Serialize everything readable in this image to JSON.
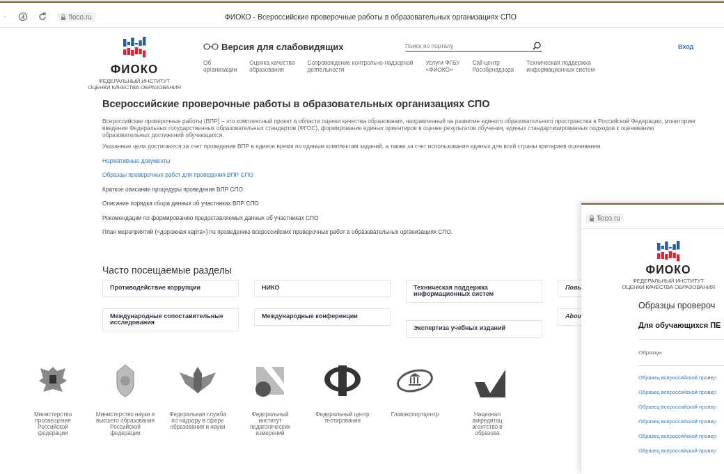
{
  "browser": {
    "url": "fioco.ru",
    "tab_title": "ФИОКО - Всероссийские проверочные работы в образовательных организациях СПО"
  },
  "header": {
    "logo_text": "ФИОКО",
    "logo_subtitle": "ФЕДЕРАЛЬНЫЙ ИНСТИТУТ\nОЦЕНКИ КАЧЕСТВА ОБРАЗОВАНИЯ",
    "accessibility_link": "Версия для слабовидящих",
    "search": {
      "placeholder": "Поиск по порталу"
    },
    "login": "Вход",
    "nav": [
      "Об\nорганизации",
      "Оценка качества\nобразования",
      "Сопровождение контрольно-надзорной\nдеятельности",
      "Услуги ФГБУ\n«ФИОКО»",
      "Call-центр\nРособрнадзора",
      "Техническая поддержка\nинформационных систем"
    ]
  },
  "article": {
    "title": "Всероссийские проверочные работы в образовательных организациях СПО",
    "paragraphs": [
      "Всероссийские проверочные работы (ВПР) – это комплексный проект в области оценки качества образования, направленный на развитие единого образовательного пространства в Российской Федерации, мониторинг введения Федеральных государственных образовательных стандартов (ФГОС), формирование единых ориентиров в оценке результатов обучения, единых стандартизированных подходов к оцениванию образовательных достижений обучающихся.",
      "Указанные цели достигаются за счет проведения ВПР в единое время по единым комплектам заданий, а также за счет использования единых для всей страны критериев оценивания."
    ],
    "links": [
      {
        "text": "Нормативные документы",
        "kind": "link"
      },
      {
        "text": "Образцы проверочных работ для проведения ВПР СПО",
        "kind": "link"
      },
      {
        "text": "Краткое описание процедуры проведения ВПР СПО",
        "kind": "plain"
      },
      {
        "text": "Описание порядка сбора данных об участниках ВПР СПО",
        "kind": "plain"
      },
      {
        "text": "Рекомендации по формированию предоставляемых данных об участниках СПО",
        "kind": "plain"
      },
      {
        "text": "План мероприятий («дорожная карта») по проведению всероссийских проверочных работ в образовательных организациях СПО.",
        "kind": "plain"
      }
    ]
  },
  "sections": {
    "title": "Часто посещаемые разделы",
    "columns": [
      [
        {
          "label": "Противодействие коррупции",
          "kind": "normal"
        },
        {
          "label": "Международные сопоставительные\nисследования",
          "kind": "normal"
        }
      ],
      [
        {
          "label": "НИКО",
          "kind": "normal"
        },
        {
          "label": "Международные конференции",
          "kind": "normal"
        }
      ],
      [
        {
          "label": "Техническая поддержка\nинформационных систем",
          "kind": "normal"
        },
        {
          "label": "Экспертиза учебных изданий",
          "kind": "normal"
        }
      ],
      [
        {
          "label": "Повы",
          "kind": "slanted"
        },
        {
          "label": "Abou",
          "kind": "slanted"
        }
      ]
    ]
  },
  "partners": [
    {
      "caption": "Министерство\nпросвещения\nРоссийской\nфедерации"
    },
    {
      "caption": "Министерство науки и\nвысшего образования\nРоссийской\nфедерации"
    },
    {
      "caption": "Федеральная служба\nпо надзору в сфере\nобразования и науки"
    },
    {
      "caption": "Федеральный\nинститут\nпедагогических\nизмерений"
    },
    {
      "caption": "Федеральный центр\nтестирования"
    },
    {
      "caption": "Главэкспертцентр"
    },
    {
      "caption": "Национал\nаккредитац\nагентство в\nобразова"
    }
  ],
  "popup_window": {
    "url": "fioco.ru",
    "logo_text": "ФИОКО",
    "logo_subtitle": "ФЕДЕРАЛЬНЫЙ ИНСТИТУТ\nОЦЕНКИ КАЧЕСТВА ОБРАЗОВАНИЯ",
    "title": "Образцы провероч",
    "subtitle": "Для обучающихся ПЕ",
    "section_label": "Образцы",
    "links": [
      "Образец всероссийской провер",
      "Образец всероссийской провер",
      "Образец всероссийской провер",
      "Образец всероссийской провер",
      "Образец всероссийской провер",
      "Образец всероссийской провер"
    ]
  }
}
